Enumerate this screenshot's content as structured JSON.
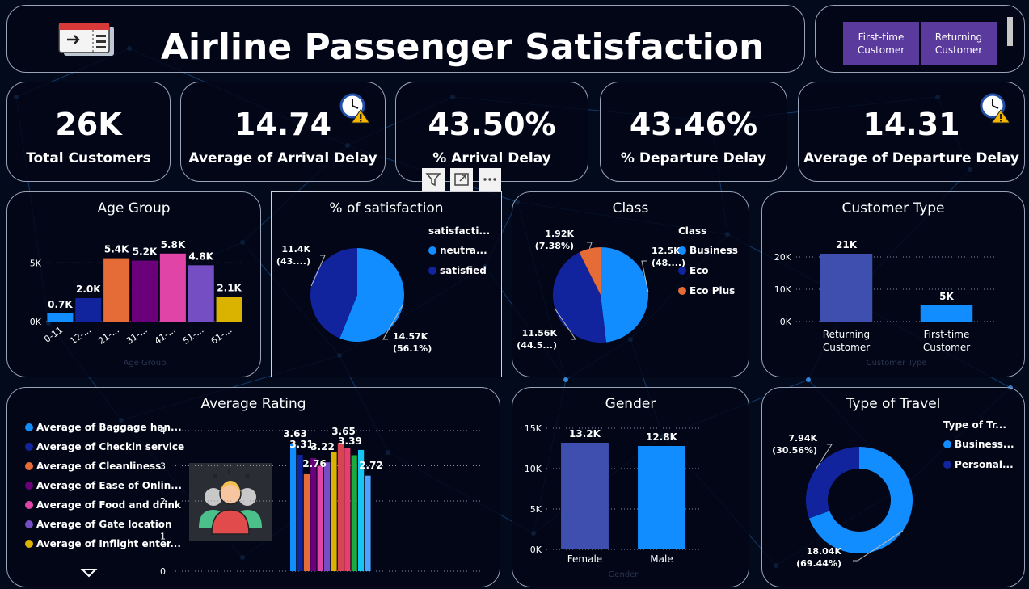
{
  "title": "Airline Passenger Satisfaction",
  "slicer": {
    "first_time": "First-time Customer",
    "returning": "Returning Customer"
  },
  "kpis": [
    {
      "value": "26K",
      "label": "Total Customers"
    },
    {
      "value": "14.74",
      "label": "Average of Arrival Delay"
    },
    {
      "value": "43.50%",
      "label": "% Arrival Delay"
    },
    {
      "value": "43.46%",
      "label": "% Departure Delay"
    },
    {
      "value": "14.31",
      "label": "Average of Departure Delay"
    }
  ],
  "icons": {
    "header": "airline-ticket-icon",
    "delay": "clock-warning-icon",
    "people": "group-people-icon",
    "filter": "filter-icon",
    "focus": "focus-mode-icon",
    "more": "more-options-icon",
    "expand": "chevron-down-icon"
  },
  "colors": {
    "bg": "#020a1c",
    "accent_purple": "#5b3a9d",
    "blue_light": "#118dff",
    "blue_dark": "#12239e",
    "orange": "#e66c37",
    "purple": "#6b007b",
    "pink": "#e044a7",
    "violet": "#744ec2",
    "gold": "#d9b300"
  },
  "chart_data": [
    {
      "id": "age_group",
      "type": "bar",
      "title": "Age Group",
      "xlabel": "Age Group",
      "ylabel": "",
      "categories": [
        "0-11",
        "12-...",
        "21-...",
        "31-...",
        "41-...",
        "51-...",
        "61-..."
      ],
      "values": [
        0.7,
        2.0,
        5.4,
        5.2,
        5.8,
        4.8,
        2.1
      ],
      "data_labels": [
        "0.7K",
        "2.0K",
        "5.4K",
        "5.2K",
        "5.8K",
        "4.8K",
        "2.1K"
      ],
      "colors": [
        "#118dff",
        "#12239e",
        "#e66c37",
        "#6b007b",
        "#e044a7",
        "#744ec2",
        "#d9b300"
      ],
      "ticks": [
        "0K",
        "5K"
      ],
      "ylim": [
        0,
        6.2
      ],
      "unit": "K"
    },
    {
      "id": "satisfaction",
      "type": "pie",
      "title": "% of satisfaction",
      "legend_title": "satisfacti...",
      "series": [
        {
          "name": "neutra...",
          "value": 14.57,
          "label": "14.57K",
          "pct": "(56.1%)",
          "color": "#118dff"
        },
        {
          "name": "satisfied",
          "value": 11.4,
          "label": "11.4K",
          "pct": "(43....)",
          "color": "#12239e"
        }
      ]
    },
    {
      "id": "class",
      "type": "pie",
      "title": "Class",
      "legend_title": "Class",
      "series": [
        {
          "name": "Business",
          "value": 12.5,
          "label": "12.5K",
          "pct": "(48....)",
          "color": "#118dff"
        },
        {
          "name": "Eco",
          "value": 11.56,
          "label": "11.56K",
          "pct": "(44.5...)",
          "color": "#12239e"
        },
        {
          "name": "Eco Plus",
          "value": 1.92,
          "label": "1.92K",
          "pct": "(7.38%)",
          "color": "#e66c37"
        }
      ]
    },
    {
      "id": "customer_type",
      "type": "bar",
      "title": "Customer Type",
      "xlabel": "Customer Type",
      "categories": [
        "Returning Customer",
        "First-time Customer"
      ],
      "values": [
        21,
        5
      ],
      "data_labels": [
        "21K",
        "5K"
      ],
      "colors": [
        "#3f4fb0",
        "#118dff"
      ],
      "ticks": [
        "0K",
        "10K",
        "20K"
      ],
      "ylim": [
        0,
        22
      ]
    },
    {
      "id": "average_rating",
      "type": "bar",
      "title": "Average Rating",
      "series": [
        {
          "name": "Average of Baggage han...",
          "value": 3.63,
          "color": "#118dff"
        },
        {
          "name": "Average of Checkin service",
          "value": 3.31,
          "color": "#12239e"
        },
        {
          "name": "Average of Cleanliness",
          "value": 2.76,
          "color": "#e66c37"
        },
        {
          "name": "Average of Ease of Onlin...",
          "value": 3.22,
          "color": "#6b007b"
        },
        {
          "name": "Average of Food and drink",
          "value": 3.0,
          "color": "#e044a7"
        },
        {
          "name": "Average of Gate location",
          "value": 3.1,
          "color": "#744ec2"
        },
        {
          "name": "Average of Inflight enter...",
          "value": 3.39,
          "color": "#d9b300"
        },
        {
          "name": "",
          "value": 3.65,
          "color": "#d64550"
        },
        {
          "name": "",
          "value": 3.5,
          "color": "#e83e6b"
        },
        {
          "name": "",
          "value": 3.3,
          "color": "#1aab40"
        },
        {
          "name": "",
          "value": 3.45,
          "color": "#15c6f4"
        },
        {
          "name": "",
          "value": 2.72,
          "color": "#4da3ff"
        }
      ],
      "value_labels": [
        "3.63",
        "3.31",
        "2.76",
        "3.22",
        "3.65",
        "3.39",
        "2.72"
      ],
      "ticks": [
        "0",
        "1",
        "2",
        "3",
        "4"
      ],
      "ylim": [
        0,
        4
      ]
    },
    {
      "id": "gender",
      "type": "bar",
      "title": "Gender",
      "xlabel": "Gender",
      "categories": [
        "Female",
        "Male"
      ],
      "values": [
        13.2,
        12.8
      ],
      "data_labels": [
        "13.2K",
        "12.8K"
      ],
      "colors": [
        "#3f4fb0",
        "#118dff"
      ],
      "ticks": [
        "0K",
        "5K",
        "10K",
        "15K"
      ],
      "ylim": [
        0,
        15
      ]
    },
    {
      "id": "type_of_travel",
      "type": "pie",
      "title": "Type of Travel",
      "legend_title": "Type of Tr...",
      "donut": true,
      "series": [
        {
          "name": "Business...",
          "value": 18.04,
          "label": "18.04K",
          "pct": "(69.44%)",
          "color": "#118dff"
        },
        {
          "name": "Personal...",
          "value": 7.94,
          "label": "7.94K",
          "pct": "(30.56%)",
          "color": "#12239e"
        }
      ]
    }
  ]
}
